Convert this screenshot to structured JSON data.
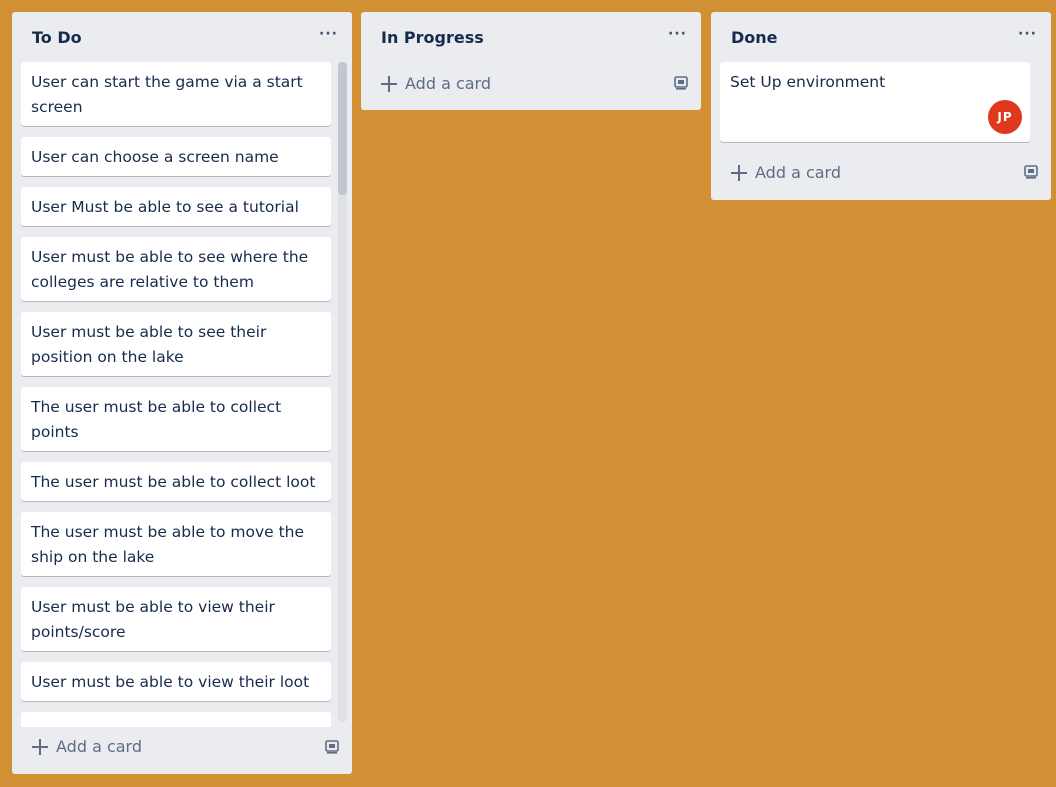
{
  "board": {
    "background_color": "#d29034",
    "lists": [
      {
        "title": "To Do",
        "menu_label": "···",
        "cards": [
          "User can start the game via a start screen",
          "User can choose a screen name",
          "User Must be able to see a tutorial",
          "User must be able to see where the colleges are relative to them",
          "User must be able to see their position on the lake",
          "The user must be able to collect points",
          "The user must be able to collect loot",
          "The user must be able to move the ship on the lake",
          "User must be able to view their points/score",
          "User must be able to view their loot"
        ],
        "add_card_label": "Add a card",
        "template_icon": "card-template-icon"
      },
      {
        "title": "In Progress",
        "menu_label": "···",
        "cards": [],
        "add_card_label": "Add a card",
        "template_icon": "card-template-icon"
      },
      {
        "title": "Done",
        "menu_label": "···",
        "cards": [
          {
            "text": "Set Up environment",
            "member_initials": "JP",
            "member_color": "#e0381d"
          }
        ],
        "add_card_label": "Add a card",
        "template_icon": "card-template-icon"
      }
    ]
  }
}
